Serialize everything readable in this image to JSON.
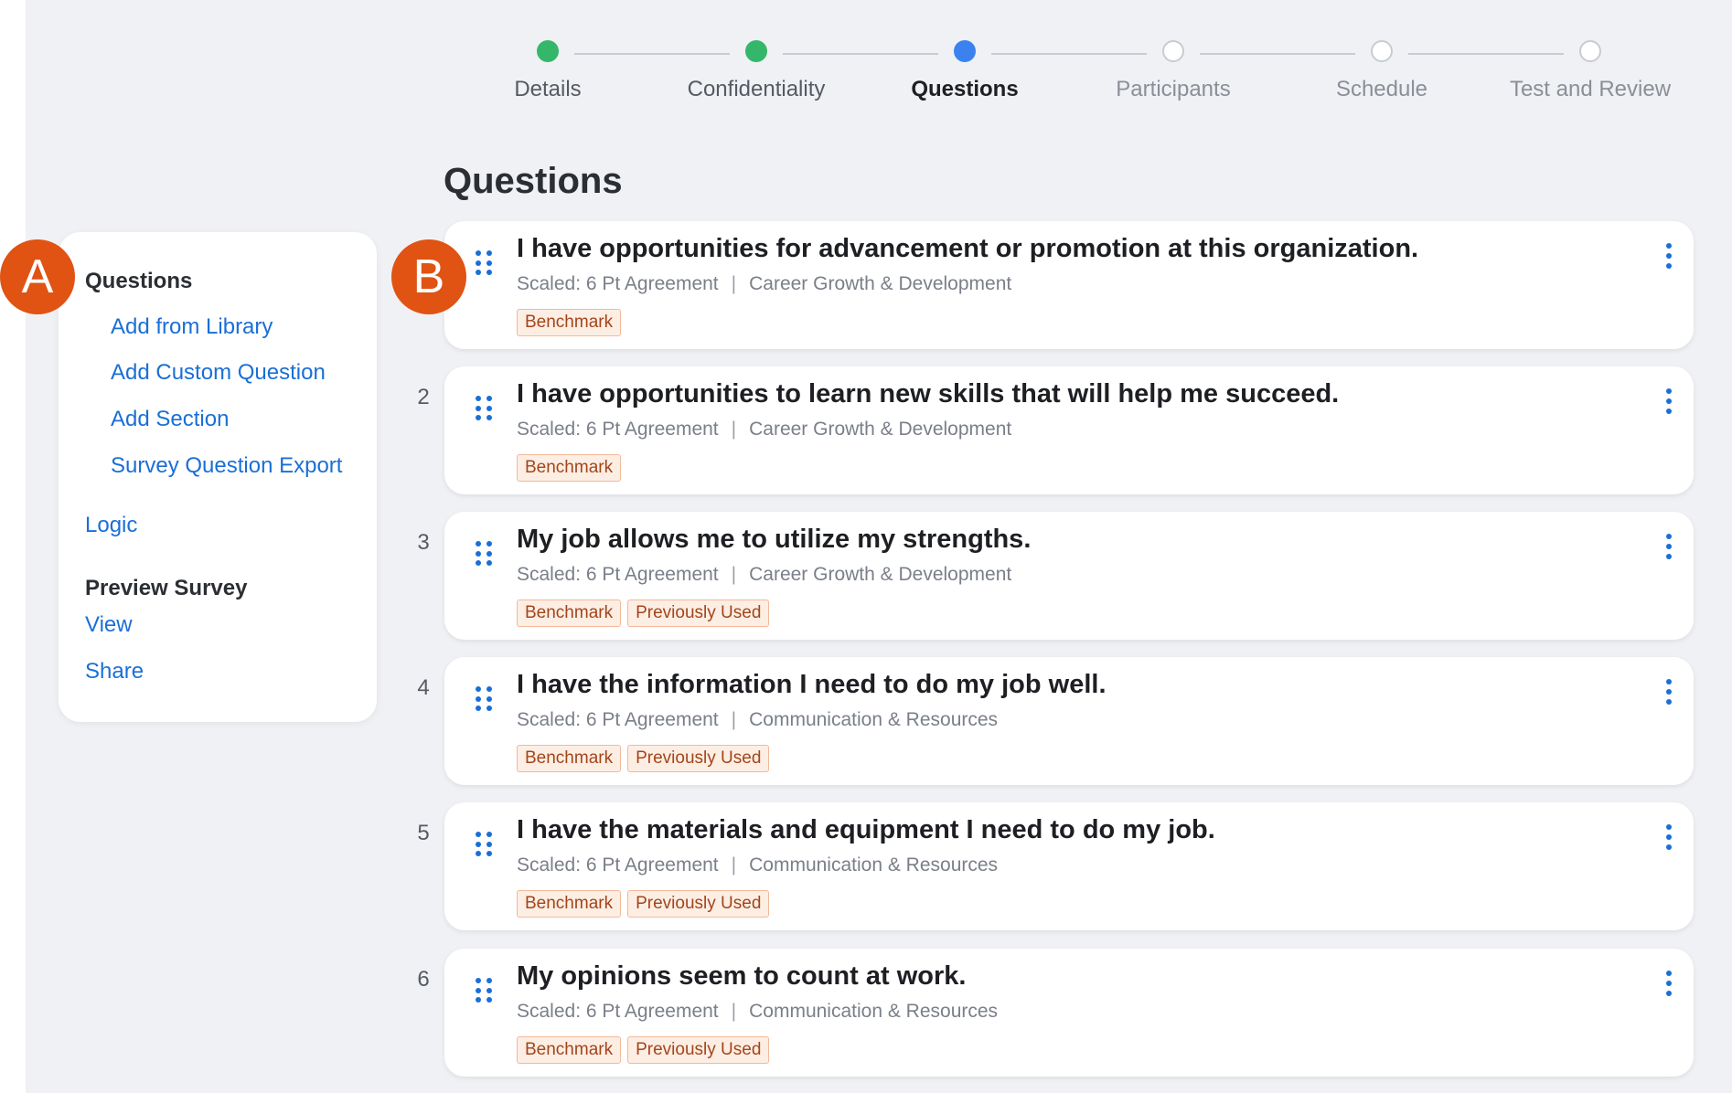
{
  "stepper": {
    "steps": [
      {
        "label": "Details",
        "state": "done"
      },
      {
        "label": "Confidentiality",
        "state": "done"
      },
      {
        "label": "Questions",
        "state": "current"
      },
      {
        "label": "Participants",
        "state": "todo"
      },
      {
        "label": "Schedule",
        "state": "todo"
      },
      {
        "label": "Test and Review",
        "state": "todo"
      }
    ]
  },
  "page": {
    "title": "Questions"
  },
  "sidebar": {
    "questions_heading": "Questions",
    "add_from_library": "Add from Library",
    "add_custom_question": "Add Custom Question",
    "add_section": "Add Section",
    "survey_question_export": "Survey Question Export",
    "logic": "Logic",
    "preview_heading": "Preview Survey",
    "view": "View",
    "share": "Share"
  },
  "callouts": {
    "a": "A",
    "b": "B"
  },
  "questions": [
    {
      "number": "",
      "text": "I have opportunities for advancement or promotion at this organization.",
      "type": "Scaled: 6 Pt Agreement",
      "category": "Career Growth & Development",
      "tags": [
        "Benchmark"
      ]
    },
    {
      "number": "2",
      "text": "I have opportunities to learn new skills that will help me succeed.",
      "type": "Scaled: 6 Pt Agreement",
      "category": "Career Growth & Development",
      "tags": [
        "Benchmark"
      ]
    },
    {
      "number": "3",
      "text": "My job allows me to utilize my strengths.",
      "type": "Scaled: 6 Pt Agreement",
      "category": "Career Growth & Development",
      "tags": [
        "Benchmark",
        "Previously Used"
      ]
    },
    {
      "number": "4",
      "text": "I have the information I need to do my job well.",
      "type": "Scaled: 6 Pt Agreement",
      "category": "Communication & Resources",
      "tags": [
        "Benchmark",
        "Previously Used"
      ]
    },
    {
      "number": "5",
      "text": "I have the materials and equipment I need to do my job.",
      "type": "Scaled: 6 Pt Agreement",
      "category": "Communication & Resources",
      "tags": [
        "Benchmark",
        "Previously Used"
      ]
    },
    {
      "number": "6",
      "text": "My opinions seem to count at work.",
      "type": "Scaled: 6 Pt Agreement",
      "category": "Communication & Resources",
      "tags": [
        "Benchmark",
        "Previously Used"
      ]
    }
  ],
  "meta_separator": "|",
  "colors": {
    "step_done": "#34b76a",
    "step_current": "#3b82f0",
    "link_blue": "#1a6fd6",
    "callout_orange": "#e05313",
    "tag_text": "#a3451a",
    "tag_bg": "#fdeee4"
  }
}
